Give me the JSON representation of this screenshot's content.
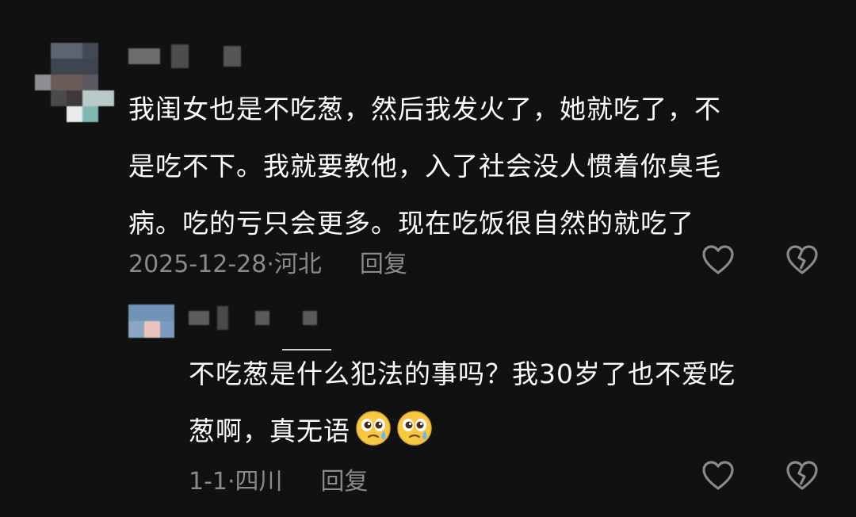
{
  "comments": [
    {
      "text_lines": [
        "我闺女也是不吃葱，然后我发火了，她就吃了，不",
        "是吃不下。我就要教他，入了社会没人惯着你臭毛",
        "病。吃的亏只会更多。现在吃饭很自然的就吃了"
      ],
      "date_location": "2025-12-28·河北",
      "reply_label": "回复"
    },
    {
      "text_lines": [
        "不吃葱是什么犯法的事吗？我30岁了也不爱吃",
        "葱啊，真无语"
      ],
      "emojis": [
        "crying-face-emoji",
        "crying-face-emoji"
      ],
      "date_location": "1-1·四川",
      "reply_label": "回复"
    }
  ],
  "icons": {
    "like": "heart-outline-icon",
    "dislike": "broken-heart-icon"
  },
  "colors": {
    "background": "#111112",
    "text": "#ffffff",
    "meta": "#8a8a8e"
  }
}
